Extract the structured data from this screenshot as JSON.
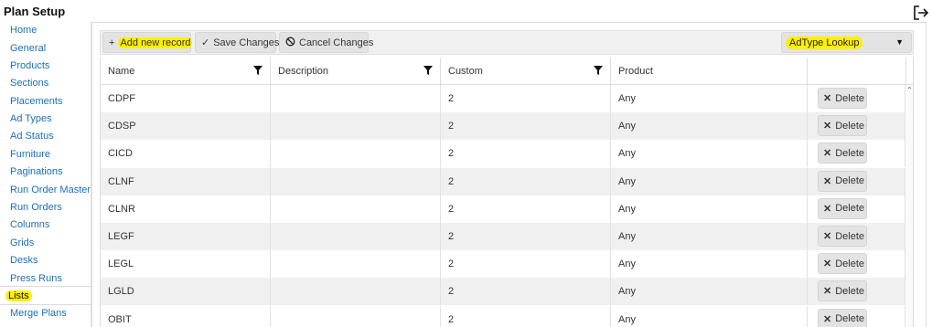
{
  "header": {
    "title": "Plan Setup"
  },
  "sidebar": {
    "items": [
      {
        "label": "Home"
      },
      {
        "label": "General"
      },
      {
        "label": "Products"
      },
      {
        "label": "Sections"
      },
      {
        "label": "Placements"
      },
      {
        "label": "Ad Types"
      },
      {
        "label": "Ad Status"
      },
      {
        "label": "Furniture"
      },
      {
        "label": "Paginations"
      },
      {
        "label": "Run Order Master"
      },
      {
        "label": "Run Orders"
      },
      {
        "label": "Columns"
      },
      {
        "label": "Grids"
      },
      {
        "label": "Desks"
      },
      {
        "label": "Press Runs"
      },
      {
        "label": "Lists"
      },
      {
        "label": "Merge Plans"
      }
    ],
    "active": "Lists"
  },
  "toolbar": {
    "add_label": "Add new record",
    "save_label": "Save Changes",
    "cancel_label": "Cancel Changes",
    "lookup_value": "AdType Lookup"
  },
  "grid": {
    "columns": [
      {
        "label": "Name"
      },
      {
        "label": "Description"
      },
      {
        "label": "Custom"
      },
      {
        "label": "Product"
      },
      {
        "label": ""
      }
    ],
    "rows": [
      {
        "name": "CDPF",
        "description": "",
        "custom": "2",
        "product": "Any"
      },
      {
        "name": "CDSP",
        "description": "",
        "custom": "2",
        "product": "Any"
      },
      {
        "name": "CICD",
        "description": "",
        "custom": "2",
        "product": "Any"
      },
      {
        "name": "CLNF",
        "description": "",
        "custom": "2",
        "product": "Any"
      },
      {
        "name": "CLNR",
        "description": "",
        "custom": "2",
        "product": "Any"
      },
      {
        "name": "LEGF",
        "description": "",
        "custom": "2",
        "product": "Any"
      },
      {
        "name": "LEGL",
        "description": "",
        "custom": "2",
        "product": "Any"
      },
      {
        "name": "LGLD",
        "description": "",
        "custom": "2",
        "product": "Any"
      },
      {
        "name": "OBIT",
        "description": "",
        "custom": "2",
        "product": "Any"
      }
    ],
    "delete_label": "Delete"
  },
  "colors": {
    "highlight": "#ffef00",
    "link": "#1e6fb8",
    "row_alt": "#f0f0f0"
  }
}
